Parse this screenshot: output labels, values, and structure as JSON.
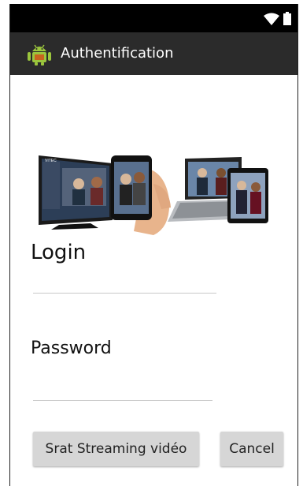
{
  "app": {
    "title": "Authentification",
    "icon": "android-robot-icon",
    "action_bar_color": "#2b2b2b"
  },
  "status_bar": {
    "icons": [
      "wifi-icon",
      "battery-icon"
    ]
  },
  "banner": {
    "description_icon": "multi-device-video-icon",
    "screen_brand": "VITEC"
  },
  "form": {
    "login_label": "Login",
    "login_value": "",
    "password_label": "Password",
    "password_value": ""
  },
  "buttons": {
    "start_label": "Srat Streaming vidéo",
    "cancel_label": "Cancel"
  }
}
